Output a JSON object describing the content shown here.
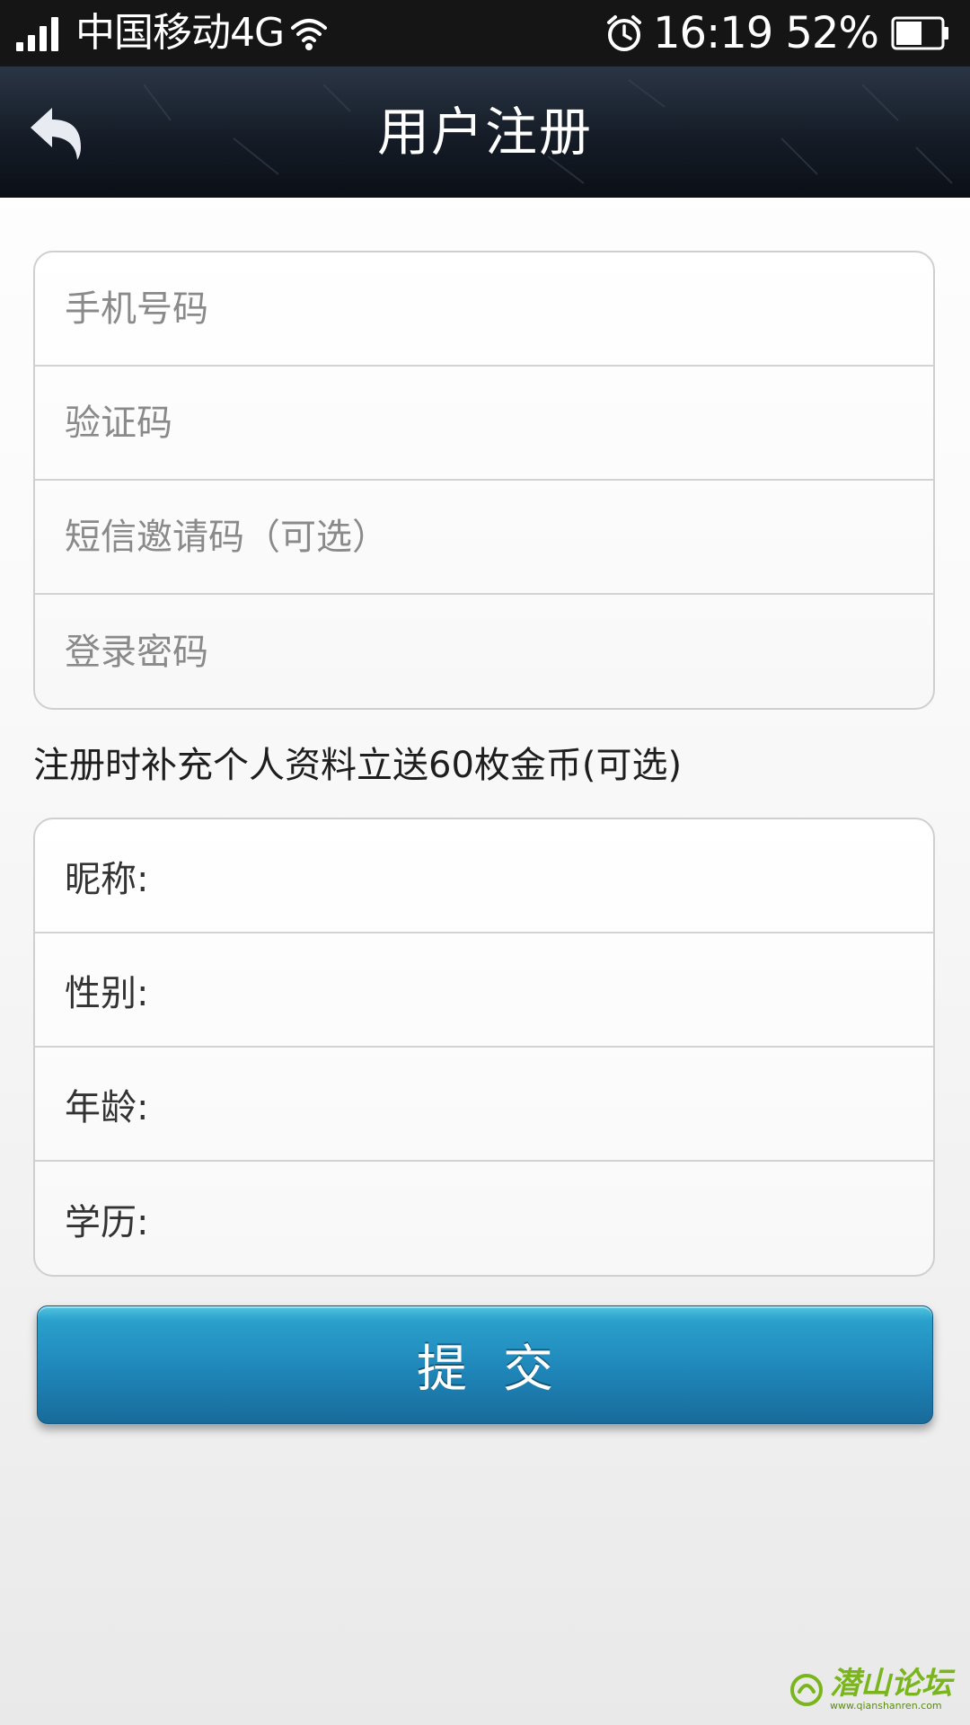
{
  "status_bar": {
    "carrier": "中国移动4G",
    "time": "16:19",
    "battery": "52%"
  },
  "nav": {
    "title": "用户注册",
    "back_icon": "back-arrow-icon"
  },
  "register_form": {
    "phone_placeholder": "手机号码",
    "code_placeholder": "验证码",
    "invite_placeholder": "短信邀请码（可选）",
    "password_placeholder": "登录密码"
  },
  "profile_note": "注册时补充个人资料立送60枚金币(可选)",
  "profile_form": {
    "nickname_label": "昵称:",
    "gender_label": "性别:",
    "age_label": "年龄:",
    "education_label": "学历:"
  },
  "submit": {
    "label": "提交"
  },
  "watermark": {
    "text": "潜山论坛",
    "url": "www.qianshanren.com"
  },
  "colors": {
    "accent": "#1f86b9",
    "nav_bg": "#151c27",
    "status_bg": "#151515",
    "watermark": "#7ab51d"
  }
}
